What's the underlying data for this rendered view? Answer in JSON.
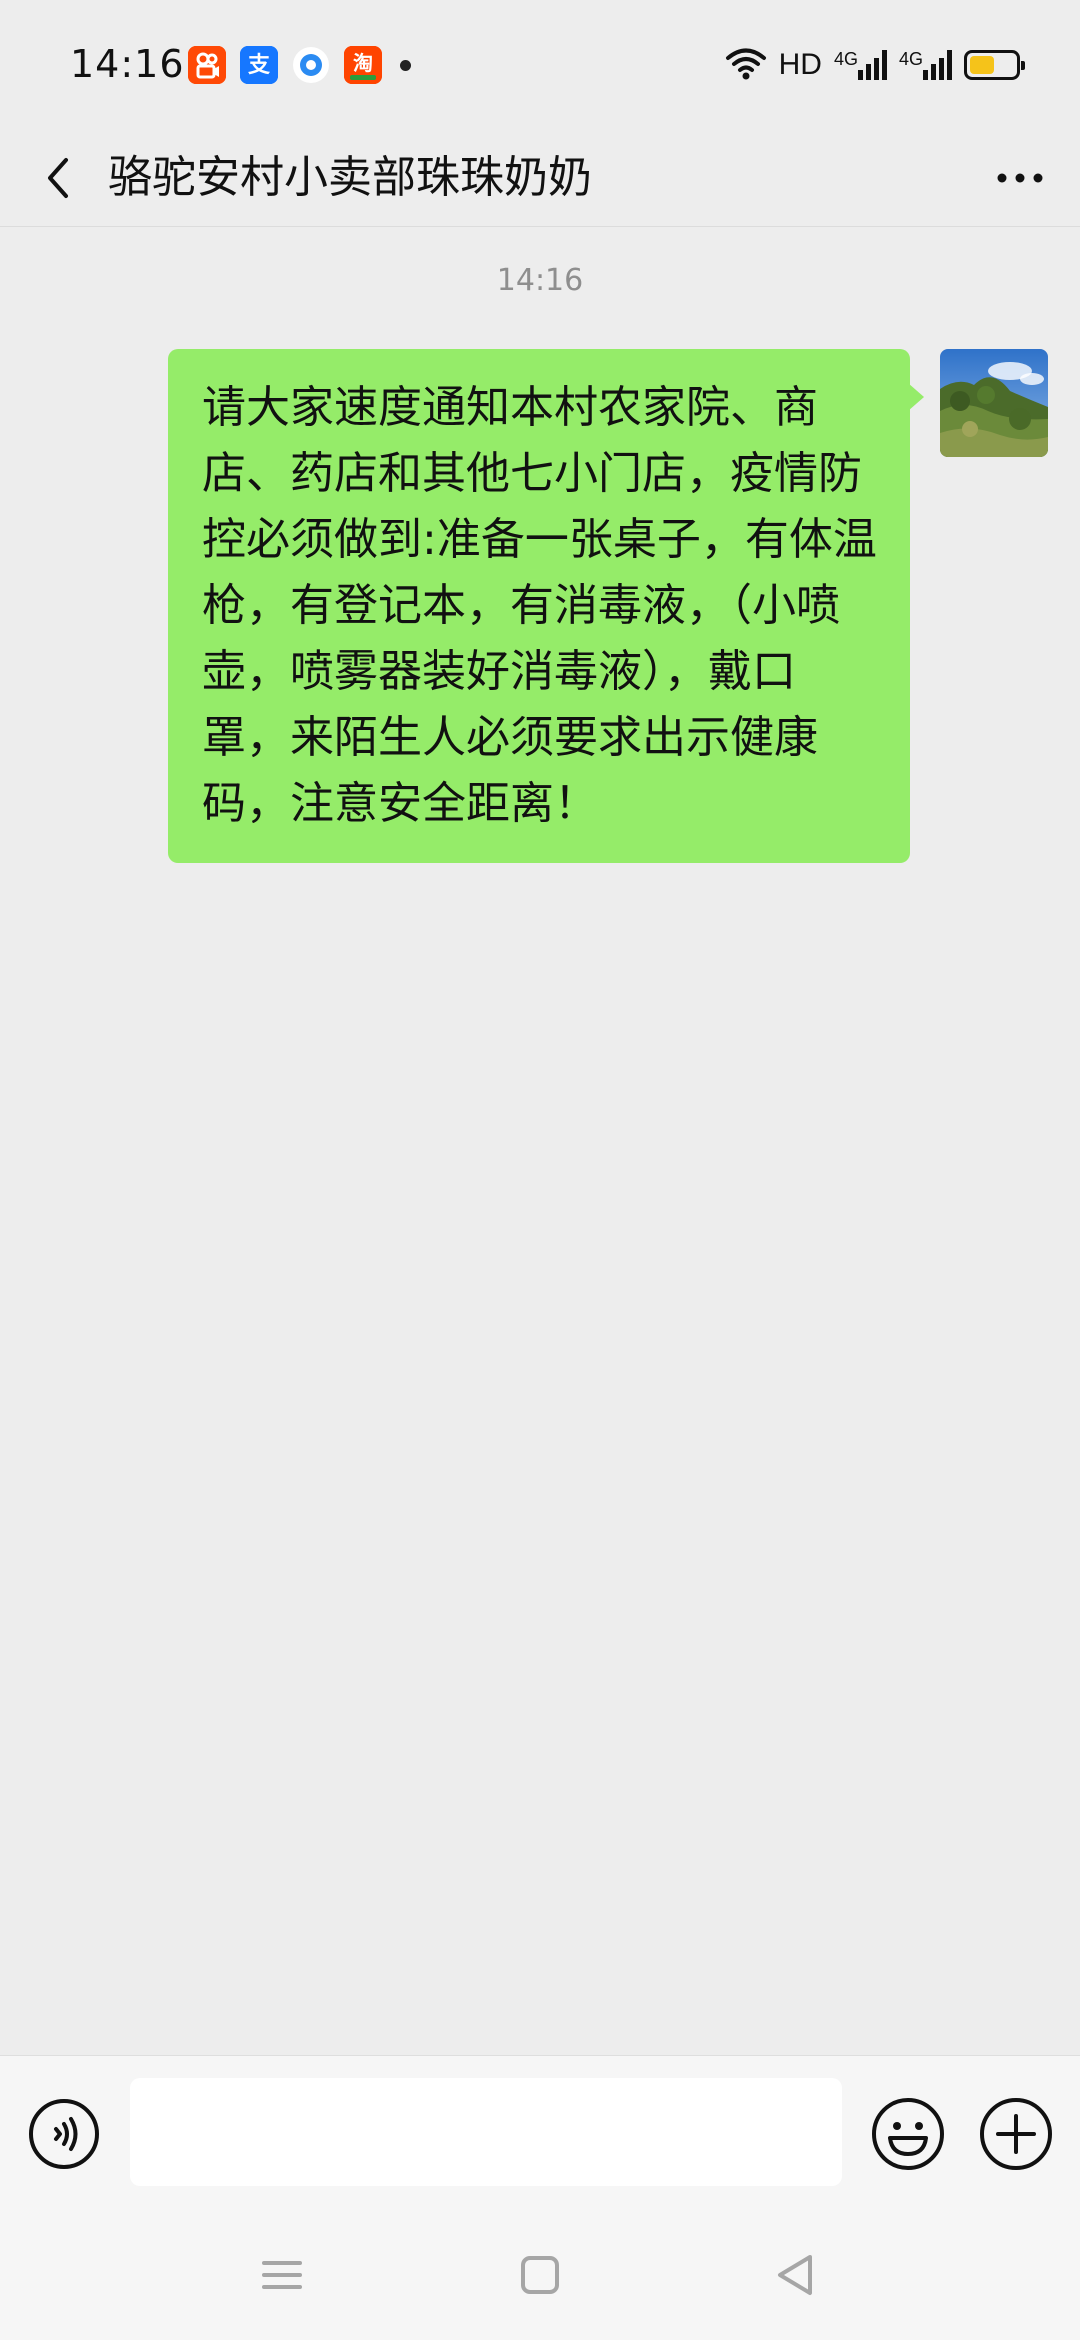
{
  "status_bar": {
    "time": "14:16",
    "app_icons": [
      {
        "name": "kuaishou-icon",
        "glyph": "快",
        "color": "#ff4906"
      },
      {
        "name": "alipay-icon",
        "glyph": "支",
        "color": "#1677ff"
      },
      {
        "name": "browser-icon",
        "glyph": "",
        "color": "#2b8bf2"
      },
      {
        "name": "taobao-icon",
        "glyph": "淘",
        "color": "#ff4400"
      }
    ],
    "wifi": "wifi-icon",
    "hd_label": "HD",
    "network_labels": [
      "4G",
      "4G"
    ],
    "battery_level": 0.55,
    "battery_color": "#f5c31a"
  },
  "header": {
    "back_icon": "chevron-left-icon",
    "title": "骆驼安村小卖部珠珠奶奶",
    "more_icon": "more-dots-icon"
  },
  "messages": [
    {
      "time": "14:16",
      "sender": "self",
      "text": "请大家速度通知本村农家院、商店、药店和其他七小门店，疫情防控必须做到:准备一张桌子，有体温枪，有登记本，有消毒液，（小喷壶，喷雾器装好消毒液），戴口罩，来陌生人必须要求出示健康码，注意安全距离！",
      "bubble_color": "#95ec69"
    }
  ],
  "input_bar": {
    "voice_icon": "voice-icon",
    "placeholder": "",
    "value": "",
    "emoji_icon": "emoji-icon",
    "plus_icon": "plus-icon"
  },
  "nav_bar": {
    "icons": [
      "menu-icon",
      "home-icon",
      "back-triangle-icon"
    ]
  },
  "colors": {
    "background": "#ededed",
    "accent": "#95ec69"
  }
}
